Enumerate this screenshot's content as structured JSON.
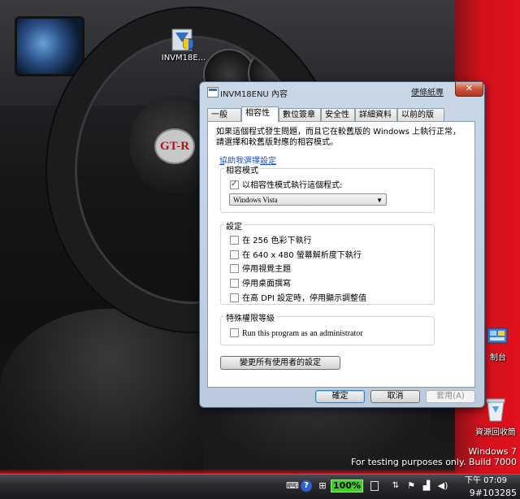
{
  "desktop": {
    "setup_icon_label": "INVM18E...",
    "control_panel_label": "制台",
    "recycle_bin_label": "資源回收筒",
    "windows_version": "Windows 7",
    "build_notice": "For testing purposes only. Build 7000",
    "wheel_logo": "GT-R"
  },
  "dialog": {
    "title": "INVM18ENU 內容",
    "sticky_label": "便條紙專",
    "close_symbol": "✕",
    "tabs": [
      {
        "label": "一般"
      },
      {
        "label": "相容性",
        "active": true
      },
      {
        "label": "數位簽章"
      },
      {
        "label": "安全性"
      },
      {
        "label": "詳細資料"
      },
      {
        "label": "以前的版本"
      }
    ],
    "intro": "如果這個程式發生問題，而且它在較舊版的 Windows 上執行正常，請選擇和較舊版對應的相容模式。",
    "help_link": "協助我選擇設定",
    "compat_group": {
      "title": "相容模式",
      "checkbox_label": "以相容性模式執行這個程式:",
      "checked": true,
      "selected_os": "Windows Vista",
      "dropdown_arrow": "▼"
    },
    "settings_group": {
      "title": "設定",
      "items": [
        {
          "label": "在 256 色彩下執行",
          "checked": false
        },
        {
          "label": "在 640 x 480 螢幕解析度下執行",
          "checked": false
        },
        {
          "label": "停用視覺主題",
          "checked": false
        },
        {
          "label": "停用桌面撰寫",
          "checked": false
        },
        {
          "label": "在高 DPI 設定時，停用顯示調整值",
          "checked": false
        }
      ]
    },
    "privilege_group": {
      "title": "特殊權限等級",
      "checkbox_label": "Run this program as an administrator",
      "checked": false
    },
    "change_all_button": "變更所有使用者的設定",
    "buttons": {
      "ok": "確定",
      "cancel": "取消",
      "apply": "套用(A)"
    }
  },
  "taskbar": {
    "zoom": "100%",
    "help_symbol": "?",
    "time": "下午 07:09",
    "date": "9#103285"
  }
}
